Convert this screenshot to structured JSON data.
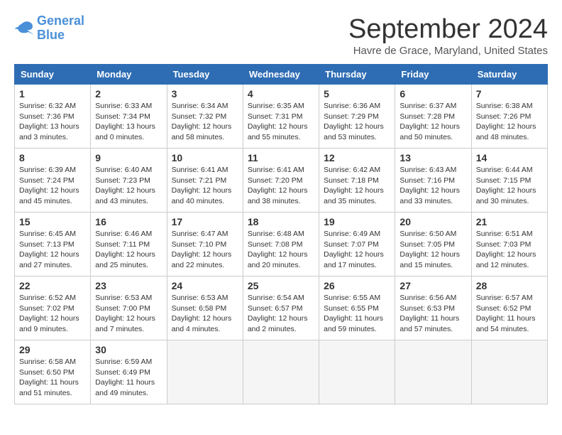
{
  "logo": {
    "line1": "General",
    "line2": "Blue"
  },
  "title": "September 2024",
  "subtitle": "Havre de Grace, Maryland, United States",
  "headers": [
    "Sunday",
    "Monday",
    "Tuesday",
    "Wednesday",
    "Thursday",
    "Friday",
    "Saturday"
  ],
  "weeks": [
    [
      {
        "day": "1",
        "sunrise": "6:32 AM",
        "sunset": "7:36 PM",
        "daylight": "13 hours and 3 minutes"
      },
      {
        "day": "2",
        "sunrise": "6:33 AM",
        "sunset": "7:34 PM",
        "daylight": "13 hours and 0 minutes"
      },
      {
        "day": "3",
        "sunrise": "6:34 AM",
        "sunset": "7:32 PM",
        "daylight": "12 hours and 58 minutes"
      },
      {
        "day": "4",
        "sunrise": "6:35 AM",
        "sunset": "7:31 PM",
        "daylight": "12 hours and 55 minutes"
      },
      {
        "day": "5",
        "sunrise": "6:36 AM",
        "sunset": "7:29 PM",
        "daylight": "12 hours and 53 minutes"
      },
      {
        "day": "6",
        "sunrise": "6:37 AM",
        "sunset": "7:28 PM",
        "daylight": "12 hours and 50 minutes"
      },
      {
        "day": "7",
        "sunrise": "6:38 AM",
        "sunset": "7:26 PM",
        "daylight": "12 hours and 48 minutes"
      }
    ],
    [
      {
        "day": "8",
        "sunrise": "6:39 AM",
        "sunset": "7:24 PM",
        "daylight": "12 hours and 45 minutes"
      },
      {
        "day": "9",
        "sunrise": "6:40 AM",
        "sunset": "7:23 PM",
        "daylight": "12 hours and 43 minutes"
      },
      {
        "day": "10",
        "sunrise": "6:41 AM",
        "sunset": "7:21 PM",
        "daylight": "12 hours and 40 minutes"
      },
      {
        "day": "11",
        "sunrise": "6:41 AM",
        "sunset": "7:20 PM",
        "daylight": "12 hours and 38 minutes"
      },
      {
        "day": "12",
        "sunrise": "6:42 AM",
        "sunset": "7:18 PM",
        "daylight": "12 hours and 35 minutes"
      },
      {
        "day": "13",
        "sunrise": "6:43 AM",
        "sunset": "7:16 PM",
        "daylight": "12 hours and 33 minutes"
      },
      {
        "day": "14",
        "sunrise": "6:44 AM",
        "sunset": "7:15 PM",
        "daylight": "12 hours and 30 minutes"
      }
    ],
    [
      {
        "day": "15",
        "sunrise": "6:45 AM",
        "sunset": "7:13 PM",
        "daylight": "12 hours and 27 minutes"
      },
      {
        "day": "16",
        "sunrise": "6:46 AM",
        "sunset": "7:11 PM",
        "daylight": "12 hours and 25 minutes"
      },
      {
        "day": "17",
        "sunrise": "6:47 AM",
        "sunset": "7:10 PM",
        "daylight": "12 hours and 22 minutes"
      },
      {
        "day": "18",
        "sunrise": "6:48 AM",
        "sunset": "7:08 PM",
        "daylight": "12 hours and 20 minutes"
      },
      {
        "day": "19",
        "sunrise": "6:49 AM",
        "sunset": "7:07 PM",
        "daylight": "12 hours and 17 minutes"
      },
      {
        "day": "20",
        "sunrise": "6:50 AM",
        "sunset": "7:05 PM",
        "daylight": "12 hours and 15 minutes"
      },
      {
        "day": "21",
        "sunrise": "6:51 AM",
        "sunset": "7:03 PM",
        "daylight": "12 hours and 12 minutes"
      }
    ],
    [
      {
        "day": "22",
        "sunrise": "6:52 AM",
        "sunset": "7:02 PM",
        "daylight": "12 hours and 9 minutes"
      },
      {
        "day": "23",
        "sunrise": "6:53 AM",
        "sunset": "7:00 PM",
        "daylight": "12 hours and 7 minutes"
      },
      {
        "day": "24",
        "sunrise": "6:53 AM",
        "sunset": "6:58 PM",
        "daylight": "12 hours and 4 minutes"
      },
      {
        "day": "25",
        "sunrise": "6:54 AM",
        "sunset": "6:57 PM",
        "daylight": "12 hours and 2 minutes"
      },
      {
        "day": "26",
        "sunrise": "6:55 AM",
        "sunset": "6:55 PM",
        "daylight": "11 hours and 59 minutes"
      },
      {
        "day": "27",
        "sunrise": "6:56 AM",
        "sunset": "6:53 PM",
        "daylight": "11 hours and 57 minutes"
      },
      {
        "day": "28",
        "sunrise": "6:57 AM",
        "sunset": "6:52 PM",
        "daylight": "11 hours and 54 minutes"
      }
    ],
    [
      {
        "day": "29",
        "sunrise": "6:58 AM",
        "sunset": "6:50 PM",
        "daylight": "11 hours and 51 minutes"
      },
      {
        "day": "30",
        "sunrise": "6:59 AM",
        "sunset": "6:49 PM",
        "daylight": "11 hours and 49 minutes"
      },
      null,
      null,
      null,
      null,
      null
    ]
  ]
}
